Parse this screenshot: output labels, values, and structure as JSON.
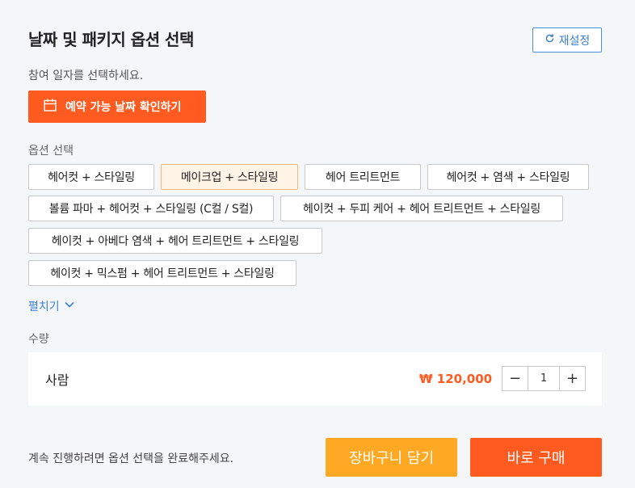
{
  "header": {
    "title": "날짜 및 패키지 옵션 선택",
    "reset_label": "재설정",
    "reset_icon": "refresh-icon"
  },
  "date": {
    "label": "참여 일자를 선택하세요.",
    "button_label": "예약 가능 날짜 확인하기",
    "button_icon": "calendar-icon"
  },
  "options": {
    "label": "옵션 선택",
    "selected_index": 1,
    "items": [
      "헤어컷 + 스타일링",
      "메이크업 + 스타일링",
      "헤어 트리트먼트",
      "헤어컷 + 염색 + 스타일링",
      "볼륨 파마 + 헤어컷 + 스타일링 (C컬 / S컬)",
      "헤이컷 + 두피 케어 + 헤어 트리트먼트 + 스타일링",
      "헤이컷 + 아베다 염색 + 헤어 트리트먼트 + 스타일링",
      "헤이컷 + 믹스펌 + 헤어 트리트먼트 + 스타일링"
    ],
    "expand_label": "펼치기"
  },
  "quantity": {
    "label": "수량",
    "person_label": "사람",
    "price": "₩ 120,000",
    "minus": "−",
    "value": "1",
    "plus": "+"
  },
  "footer": {
    "notice": "계속 진행하려면 옵션 선택을 완료해주세요.",
    "cart_label": "장바구니 담기",
    "buy_label": "바로 구매"
  },
  "colors": {
    "accent": "#ff5a1f",
    "cart": "#ffa823",
    "link": "#3a7fcf",
    "selected_bg": "#fff4e6"
  }
}
